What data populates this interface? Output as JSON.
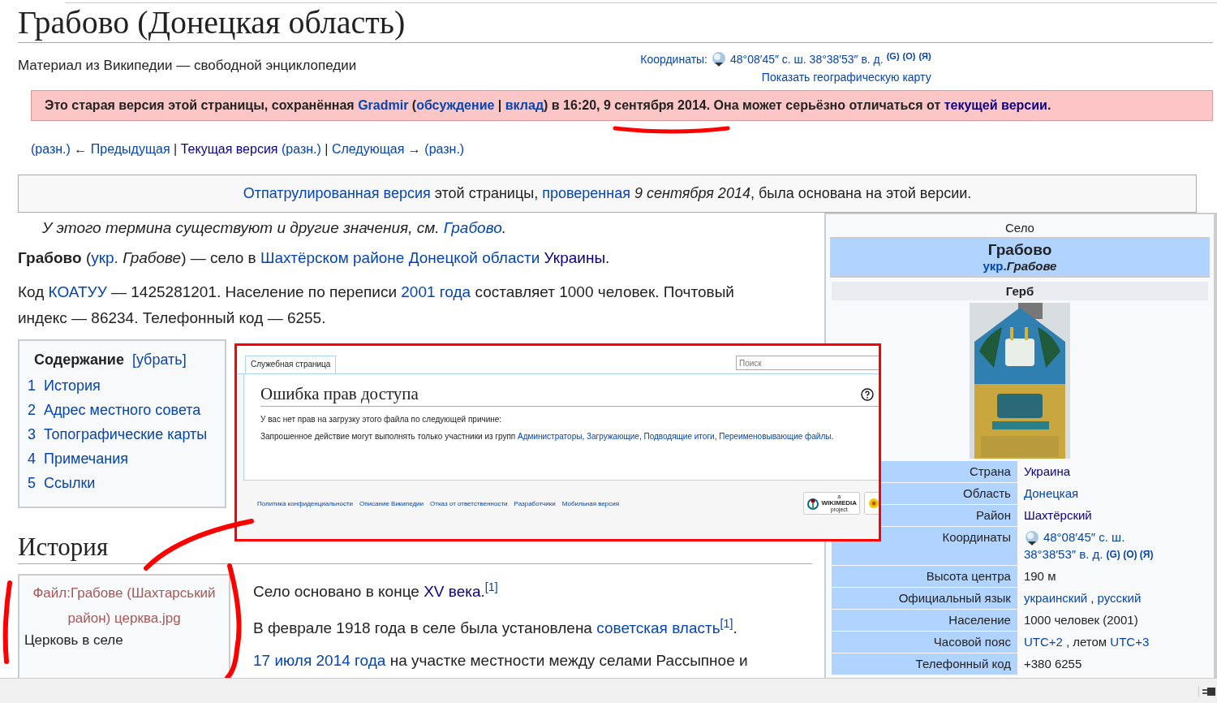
{
  "title": "Грабово (Донецкая область)",
  "tagline": "Материал из Википедии — свободной энциклопедии",
  "coordinates": {
    "label": "Координаты:",
    "value": "48°08′45″ с. ш. 38°38′53″ в. д.",
    "links": [
      "(G)",
      "(O)",
      "(Я)"
    ],
    "map_link": "Показать географическую карту"
  },
  "old_revision_notice": [
    {
      "kind": "text",
      "text": "Это старая версия этой страницы, сохранённая "
    },
    {
      "kind": "link",
      "text": "Gradmir"
    },
    {
      "kind": "text",
      "text": " ("
    },
    {
      "kind": "link",
      "text": "обсуждение"
    },
    {
      "kind": "text",
      "text": " | "
    },
    {
      "kind": "link",
      "text": "вклад"
    },
    {
      "kind": "text",
      "text": ") в 16:20, 9 сентября 2014. Она может серьёзно отличаться от "
    },
    {
      "kind": "visited",
      "text": "текущей версии"
    },
    {
      "kind": "text",
      "text": "."
    }
  ],
  "revision_nav": [
    {
      "kind": "link",
      "text": "(разн.)"
    },
    {
      "kind": "text",
      "text": " ← "
    },
    {
      "kind": "link",
      "text": "Предыдущая"
    },
    {
      "kind": "text",
      "text": " | "
    },
    {
      "kind": "visited",
      "text": "Текущая версия"
    },
    {
      "kind": "link",
      "text": " (разн.)"
    },
    {
      "kind": "text",
      "text": " | "
    },
    {
      "kind": "link",
      "text": "Следующая"
    },
    {
      "kind": "text",
      "text": " → "
    },
    {
      "kind": "link",
      "text": "(разн.)"
    }
  ],
  "flagged_notice": [
    {
      "kind": "link",
      "text": "Отпатрулированная версия"
    },
    {
      "kind": "text",
      "text": " этой страницы, "
    },
    {
      "kind": "link",
      "text": "проверенная"
    },
    {
      "kind": "text",
      "text": " *9 сентября 2014*, была основана на этой версии."
    }
  ],
  "hatnote": [
    {
      "kind": "text",
      "text": "У этого термина существуют и другие значения, см. "
    },
    {
      "kind": "link",
      "text": "Грабово"
    },
    {
      "kind": "text",
      "text": "."
    }
  ],
  "paragraphs": [
    [
      {
        "kind": "text",
        "text": "**Грабово** ("
      },
      {
        "kind": "link",
        "text": "укр."
      },
      {
        "kind": "text",
        "text": " *Грабове*) — село в "
      },
      {
        "kind": "link",
        "text": "Шахтёрском районе"
      },
      {
        "kind": "link",
        "text": " Донецкой области"
      },
      {
        "kind": "visited",
        "text": " Украины"
      },
      {
        "kind": "text",
        "text": "."
      }
    ],
    [
      {
        "kind": "text",
        "text": "Код "
      },
      {
        "kind": "link",
        "text": "КОАТУУ"
      },
      {
        "kind": "text",
        "text": " — 1425281201. Население по переписи "
      },
      {
        "kind": "link",
        "text": "2001 года"
      },
      {
        "kind": "text",
        "text": " составляет 1000 человек. Почтовый индекс — 86234. Телефонный код — 6255."
      }
    ]
  ],
  "toc": {
    "title": "Содержание",
    "toggle": "[убрать]",
    "items": [
      {
        "number": "1",
        "text": "История"
      },
      {
        "number": "2",
        "text": "Адрес местного совета"
      },
      {
        "number": "3",
        "text": "Топографические карты"
      },
      {
        "number": "4",
        "text": "Примечания"
      },
      {
        "number": "5",
        "text": "Ссылки"
      }
    ]
  },
  "section_heading": "История",
  "thumbnail": {
    "file_link": "Файл:Грабове (Шахтарський район) церква.jpg",
    "caption": "Церковь в селе"
  },
  "history_paragraphs": [
    [
      {
        "kind": "text",
        "text": "Село основано в конце "
      },
      {
        "kind": "visited",
        "text": "XV века"
      },
      {
        "kind": "text",
        "text": "."
      },
      {
        "kind": "ref",
        "text": "[1]"
      }
    ],
    [
      {
        "kind": "text",
        "text": "В феврале 1918 года в селе была установлена "
      },
      {
        "kind": "link",
        "text": "советская власть"
      },
      {
        "kind": "ref",
        "text": "[1]"
      },
      {
        "kind": "text",
        "text": "."
      }
    ],
    [
      {
        "kind": "link",
        "text": "17 июля 2014 года"
      },
      {
        "kind": "text",
        "text": " на участке местности между селами Рассыпное и"
      }
    ]
  ],
  "infobox": {
    "type": "Село",
    "name": "Грабово",
    "native_lang": "укр.",
    "native_name": "Грабове",
    "emblem_caption": "Герб",
    "rows": [
      {
        "label": "Страна",
        "value": [
          {
            "kind": "visited",
            "text": "Украина"
          }
        ]
      },
      {
        "label": "Область",
        "value": [
          {
            "kind": "link",
            "text": "Донецкая"
          }
        ]
      },
      {
        "label": "Район",
        "value": [
          {
            "kind": "visited",
            "text": "Шахтёрский"
          }
        ]
      },
      {
        "label": "Координаты",
        "value": [
          {
            "kind": "globe"
          },
          {
            "kind": "link",
            "text": "48°08′45″ с. ш."
          },
          {
            "kind": "link",
            "text": "38°38′53″ в. д."
          },
          {
            "kind": "ref",
            "text": "(G) (O) (Я)"
          }
        ]
      },
      {
        "label": "Высота центра",
        "value": [
          {
            "kind": "text",
            "text": "190 м"
          }
        ]
      },
      {
        "label": "Официальный язык",
        "value": [
          {
            "kind": "link",
            "text": "украинский"
          },
          {
            "kind": "text",
            "text": ", "
          },
          {
            "kind": "link",
            "text": "русский"
          }
        ]
      },
      {
        "label": "Население",
        "value": [
          {
            "kind": "text",
            "text": "1000 человек (2001)"
          }
        ]
      },
      {
        "label": "Часовой пояс",
        "value": [
          {
            "kind": "link",
            "text": "UTC+2"
          },
          {
            "kind": "text",
            "text": ", летом "
          },
          {
            "kind": "link",
            "text": "UTC+3"
          }
        ]
      },
      {
        "label": "Телефонный код",
        "value": [
          {
            "kind": "text",
            "text": "+380 6255"
          }
        ]
      }
    ]
  },
  "inset": {
    "tab": "Служебная страница",
    "search_placeholder": "Поиск",
    "heading": "Ошибка прав доступа",
    "paragraphs": [
      [
        {
          "kind": "text",
          "text": "У вас нет прав на загрузку этого файла по следующей причине:"
        }
      ],
      [
        {
          "kind": "text",
          "text": "Запрошенное действие могут выполнять только участники из групп "
        },
        {
          "kind": "link",
          "text": "Администраторы"
        },
        {
          "kind": "text",
          "text": ", "
        },
        {
          "kind": "link",
          "text": "Загружающие"
        },
        {
          "kind": "text",
          "text": ", "
        },
        {
          "kind": "link",
          "text": "Подводящие итоги"
        },
        {
          "kind": "text",
          "text": ", "
        },
        {
          "kind": "link",
          "text": "Переименовывающие файлы"
        },
        {
          "kind": "text",
          "text": "."
        }
      ]
    ],
    "footer_links": [
      "Политика конфиденциальности",
      "Описание Википедии",
      "Отказ от ответственности",
      "Разработчики",
      "Мобильная версия"
    ],
    "badge_small": "a",
    "badge_brand": "WIKIMEDIA",
    "badge_sub": "project"
  }
}
